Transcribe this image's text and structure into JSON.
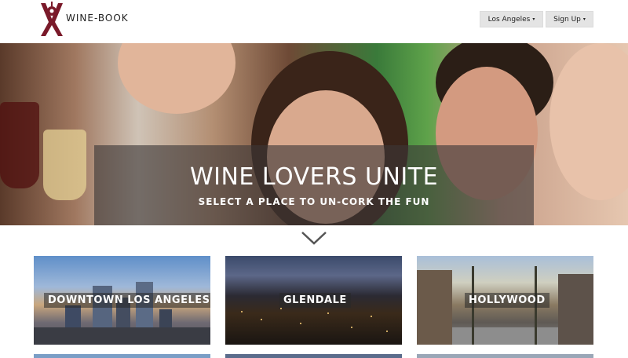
{
  "header": {
    "brand": "WINE-BOOK",
    "city_label": "Los Angeles",
    "signup_label": "Sign Up",
    "caret": "▾"
  },
  "hero": {
    "title": "WINE LOVERS UNITE",
    "subtitle": "SELECT A PLACE TO UN-CORK THE FUN"
  },
  "cards": [
    {
      "label": "DOWNTOWN LOS ANGELES"
    },
    {
      "label": "GLENDALE"
    },
    {
      "label": "HOLLYWOOD"
    }
  ],
  "colors": {
    "logo": "#7a1a2a",
    "button_bg": "#e4e4e4",
    "overlay": "#3c3737"
  }
}
